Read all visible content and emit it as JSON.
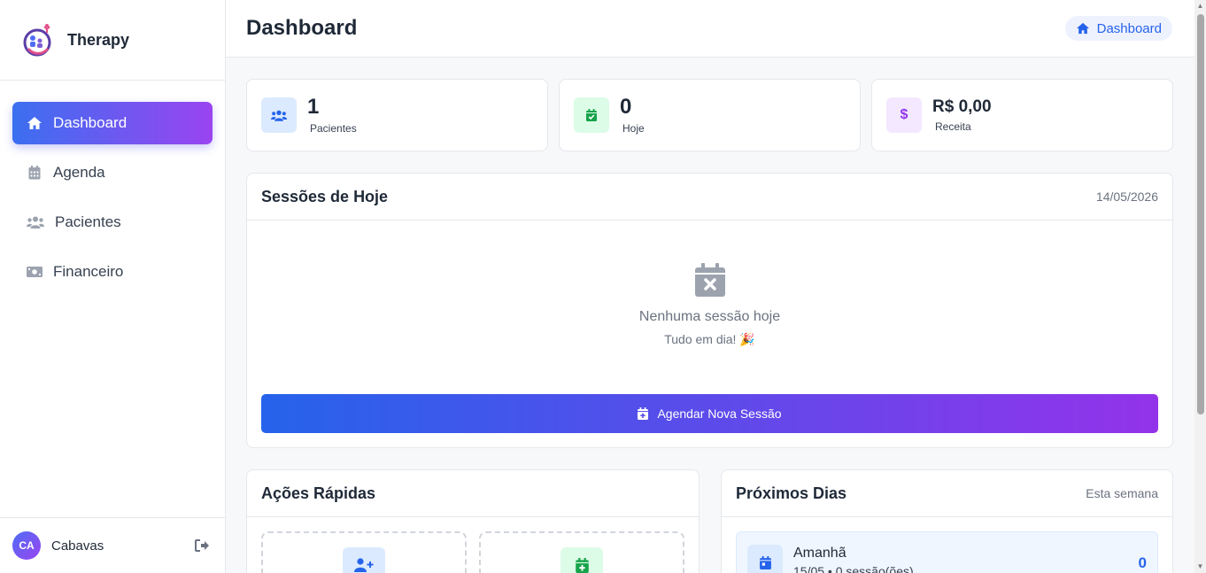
{
  "app": {
    "name": "Therapy"
  },
  "sidebar": {
    "items": [
      {
        "label": "Dashboard",
        "icon": "home-icon",
        "active": true
      },
      {
        "label": "Agenda",
        "icon": "calendar-icon",
        "active": false
      },
      {
        "label": "Pacientes",
        "icon": "users-icon",
        "active": false
      },
      {
        "label": "Financeiro",
        "icon": "money-icon",
        "active": false
      }
    ],
    "user": {
      "initials": "CA",
      "name": "Cabavas"
    }
  },
  "header": {
    "title": "Dashboard",
    "breadcrumb": "Dashboard"
  },
  "stats": [
    {
      "value": "1",
      "label": "Pacientes",
      "icon": "users-icon",
      "color": "#2563eb"
    },
    {
      "value": "0",
      "label": "Hoje",
      "icon": "calendar-check-icon",
      "color": "#16a34a"
    },
    {
      "value": "R$ 0,00",
      "label": "Receita",
      "icon": "dollar-icon",
      "color": "#9333ea"
    }
  ],
  "sessions": {
    "title": "Sessões de Hoje",
    "date": "14/05/2026",
    "empty_title": "Nenhuma sessão hoje",
    "empty_sub": "Tudo em dia! 🎉",
    "cta_label": "Agendar Nova Sessão"
  },
  "quick_actions": {
    "title": "Ações Rápidas"
  },
  "upcoming": {
    "title": "Próximos Dias",
    "meta": "Esta semana",
    "days": [
      {
        "name": "Amanhã",
        "sub": "15/05 • 0 sessão(ões)",
        "count": "0"
      }
    ]
  },
  "colors": {
    "accent_start": "#2563eb",
    "accent_end": "#9333ea",
    "text": "#1f2937",
    "muted": "#6b7280"
  }
}
